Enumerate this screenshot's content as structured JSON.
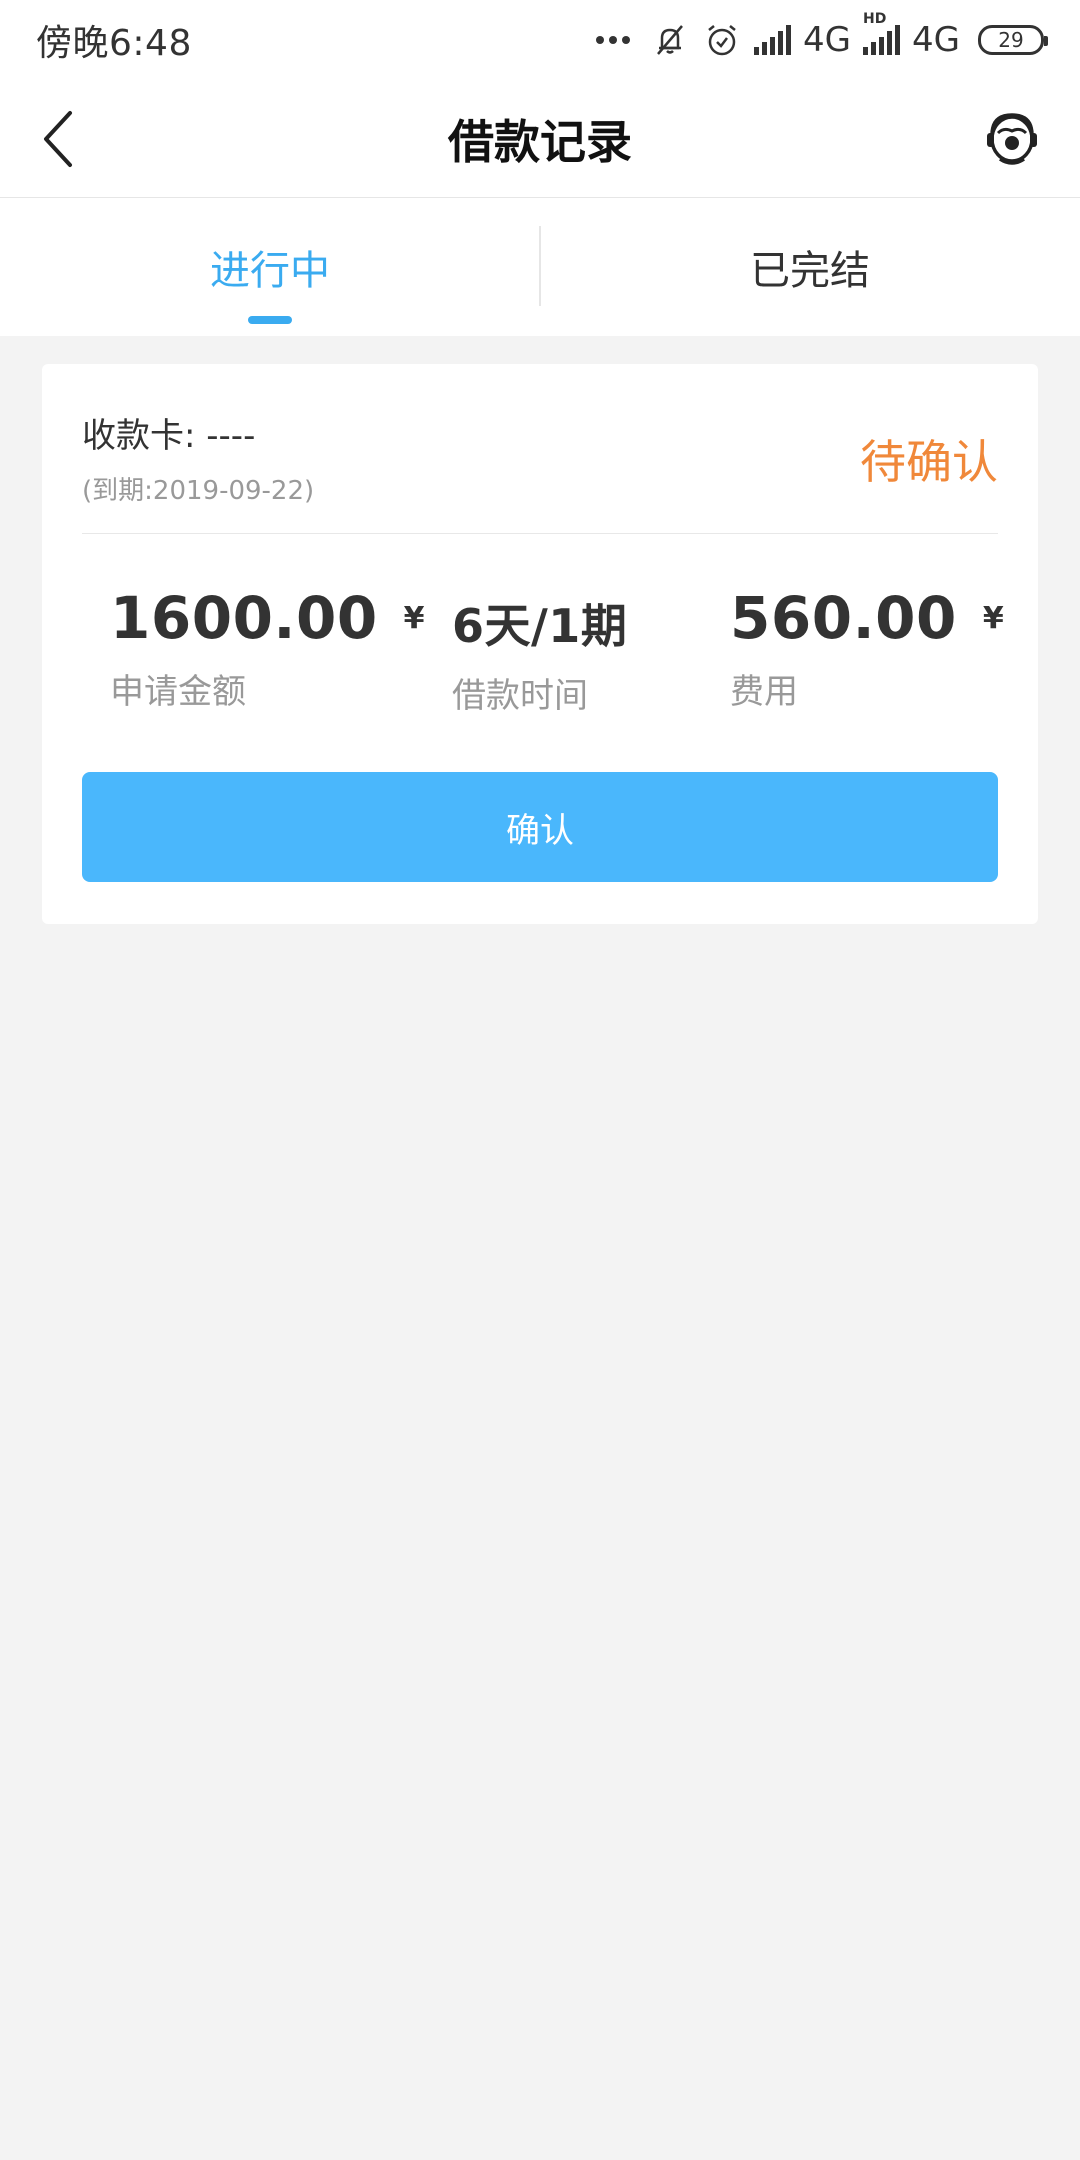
{
  "status_bar": {
    "time": "傍晚6:48",
    "network1": "4G",
    "network2_badge": "HD",
    "network2": "4G",
    "battery": "29"
  },
  "nav": {
    "title": "借款记录",
    "back_icon": "chevron-left-icon",
    "service_icon": "customer-service-icon"
  },
  "tabs": [
    {
      "label": "进行中",
      "active": true
    },
    {
      "label": "已完结",
      "active": false
    }
  ],
  "record": {
    "card_label": "收款卡: ----",
    "due": "(到期:2019-09-22)",
    "status": "待确认",
    "amount": {
      "value": "1600.00",
      "unit": "¥",
      "caption": "申请金额"
    },
    "term": {
      "value": "6天/1期",
      "caption": "借款时间"
    },
    "fee": {
      "value": "560.00",
      "unit": "¥",
      "caption": "费用"
    },
    "confirm_label": "确认"
  },
  "colors": {
    "accent": "#3aabf0",
    "button": "#4ab7fc",
    "status_pending": "#f0883a",
    "background": "#f3f3f3"
  }
}
